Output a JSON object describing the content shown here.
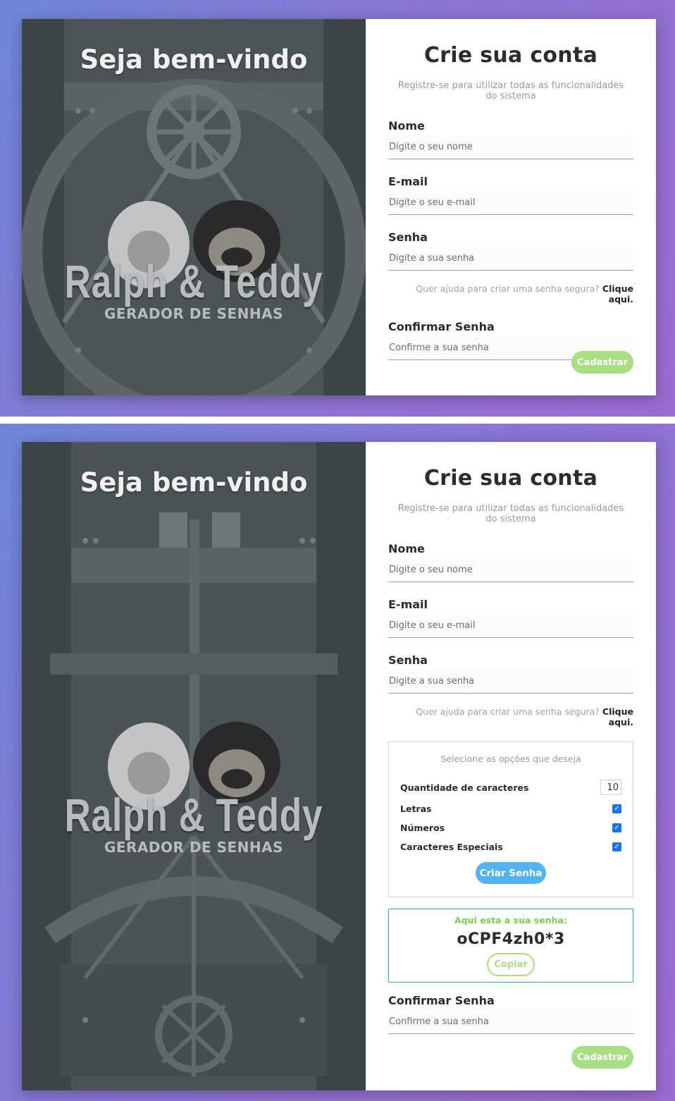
{
  "screens": [
    {
      "welcome": "Seja bem-vindo",
      "logo": {
        "title": "Ralph & Teddy",
        "subtitle": "GERADOR DE SENHAS"
      },
      "form": {
        "title": "Crie sua conta",
        "subtitle": "Registre-se para utilizar todas as funcionalidades do sistema",
        "name_label": "Nome",
        "name_placeholder": "Digite o seu nome",
        "email_label": "E-mail",
        "email_placeholder": "Digite o seu e-mail",
        "password_label": "Senha",
        "password_placeholder": "Digite a sua senha",
        "help_text": "Quer ajuda para criar uma senha segura?",
        "help_link": "Clique aqui.",
        "confirm_label": "Confirmar Senha",
        "confirm_placeholder": "Confirme a sua senha",
        "register_button": "Cadastrar"
      }
    },
    {
      "welcome": "Seja bem-vindo",
      "logo": {
        "title": "Ralph & Teddy",
        "subtitle": "GERADOR DE SENHAS"
      },
      "form": {
        "title": "Crie sua conta",
        "subtitle": "Registre-se para utilizar todas as funcionalidades do sistema",
        "name_label": "Nome",
        "name_placeholder": "Digite o seu nome",
        "email_label": "E-mail",
        "email_placeholder": "Digite o seu e-mail",
        "password_label": "Senha",
        "password_placeholder": "Digite a sua senha",
        "help_text": "Quer ajuda para criar uma senha segura?",
        "help_link": "Clique aqui.",
        "options": {
          "title": "Selecione as opções que deseja",
          "quantity_label": "Quantidade de caracteres",
          "quantity_value": "10",
          "letters_label": "Letras",
          "letters_checked": true,
          "numbers_label": "Números",
          "numbers_checked": true,
          "special_label": "Caracteres Especiais",
          "special_checked": true,
          "create_button": "Criar Senha"
        },
        "result": {
          "label": "Aqui esta a sua senha:",
          "password": "oCPF4zh0*3",
          "copy_button": "Copiar"
        },
        "confirm_label": "Confirmar Senha",
        "confirm_placeholder": "Confirme a sua senha",
        "register_button": "Cadastrar"
      }
    }
  ],
  "colors": {
    "accent_green": "#a8df82",
    "accent_blue": "#52b3f0",
    "result_border": "#2b9fd6",
    "result_label": "#7ecb4f",
    "background_start": "#6f86d6",
    "background_end": "#9a6bcf"
  },
  "icons": [
    "checkbox-checked-icon"
  ]
}
